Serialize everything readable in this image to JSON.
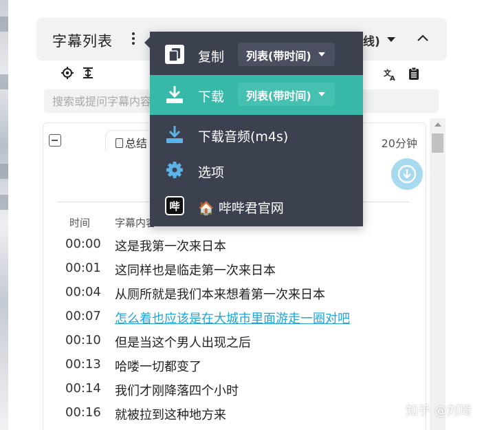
{
  "panel": {
    "title": "字幕列表",
    "hidden_tail": "线)",
    "search_placeholder": "搜索或提问字幕内容"
  },
  "card": {
    "summary_tab": "总结",
    "duration": "20分钟",
    "col_time": "时间",
    "col_text": "字幕内容"
  },
  "subtitles": [
    {
      "time": "00:00",
      "text": "这是我第一次来日本"
    },
    {
      "time": "00:01",
      "text": "这同样也是临走第一次来日本"
    },
    {
      "time": "00:04",
      "text": "从厕所就是我们本来想着第一次来日本"
    },
    {
      "time": "00:07",
      "text": "怎么着也应该是在大城市里面游走一圈对吧",
      "active": true
    },
    {
      "time": "00:10",
      "text": "但是当这个男人出现之后"
    },
    {
      "time": "00:13",
      "text": "哈喽一切都变了"
    },
    {
      "time": "00:14",
      "text": "我们才刚降落四个小时"
    },
    {
      "time": "00:16",
      "text": "就被拉到这种地方来"
    }
  ],
  "menu": {
    "copy": {
      "label": "复制",
      "select": "列表(带时间)",
      "icon": "copy-icon"
    },
    "download": {
      "label": "下载",
      "select": "列表(带时间)",
      "icon": "download-icon"
    },
    "download_audio": {
      "label": "下载音频(m4s)",
      "icon": "download-icon"
    },
    "options": {
      "label": "选项",
      "icon": "gear-icon"
    },
    "site": {
      "label": "🏠 哔哔君官网",
      "badge": "哔",
      "icon": "bibi-logo-icon"
    }
  },
  "colors": {
    "menu_bg": "#3c4150",
    "menu_highlight": "#38b8a8",
    "active_link": "#1ea5d9"
  },
  "watermark": "知乎 @刘琦"
}
